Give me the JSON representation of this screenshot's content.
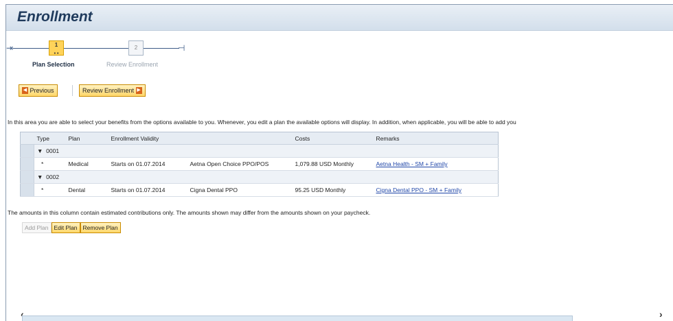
{
  "header": {
    "title": "Enrollment"
  },
  "roadmap": {
    "steps": [
      {
        "number": "1",
        "label": "Plan Selection",
        "active": true
      },
      {
        "number": "2",
        "label": "Review Enrollment",
        "active": false
      }
    ]
  },
  "nav": {
    "previous_label": "Previous",
    "next_label": "Review Enrollment"
  },
  "info_text": "In this area you are able to select your benefits from the options available to you. Whenever, you edit a plan the available options will display. In addition, when applicable, you will be able to add you",
  "table": {
    "headers": [
      "Type",
      "Plan",
      "Enrollment Validity",
      "Costs",
      "Remarks"
    ],
    "groups": [
      {
        "label": "0001",
        "row": {
          "type": "*",
          "plan": "Medical",
          "validity": "Starts on 01.07.2014",
          "option": "Aetna Open Choice PPO/POS",
          "costs": "1,079.88 USD Monthly",
          "remarks": "Aetna Health - SM + Family"
        }
      },
      {
        "label": "0002",
        "row": {
          "type": "*",
          "plan": "Dental",
          "validity": "Starts on 01.07.2014",
          "option": "Cigna Dental PPO",
          "costs": "95.25 USD Monthly",
          "remarks": "Cigna Dental PPO - SM + Family"
        }
      }
    ]
  },
  "note": "The amounts in this column contain estimated contributions only. The amounts shown may differ from the amounts shown on your paycheck.",
  "actions": {
    "add": "Add Plan",
    "edit": "Edit Plan",
    "remove": "Remove Plan"
  },
  "colors": {
    "accent": "#ffd76a",
    "title": "#1f3a5c",
    "link": "#1f46a8"
  }
}
